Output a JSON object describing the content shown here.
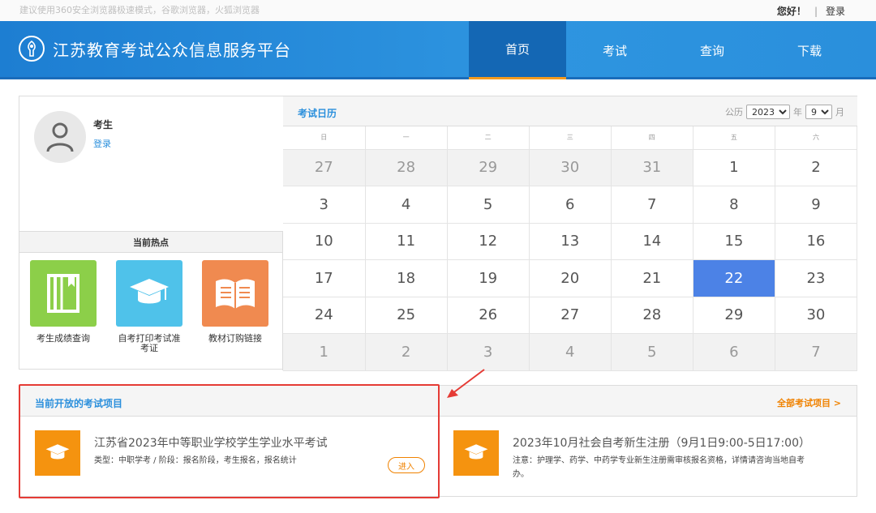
{
  "topbar": {
    "browser_tip": "建议使用360安全浏览器极速模式，谷歌浏览器，火狐浏览器",
    "greeting": "您好！",
    "separator": "|",
    "login": "登录"
  },
  "header": {
    "site_title": "江苏教育考试公众信息服务平台",
    "nav": [
      {
        "label": "首页",
        "active": true
      },
      {
        "label": "考试",
        "active": false
      },
      {
        "label": "查询",
        "active": false
      },
      {
        "label": "下载",
        "active": false
      }
    ]
  },
  "user": {
    "name": "考生",
    "login_link": "登录"
  },
  "hot": {
    "title": "当前热点",
    "tiles": [
      {
        "label": "考生成绩查询",
        "color": "#8ccf49",
        "icon": "notebook-icon"
      },
      {
        "label": "自考打印考试准考证",
        "color": "#4fc2ea",
        "icon": "graduation-cap-icon"
      },
      {
        "label": "教材订购链接",
        "color": "#f08a50",
        "icon": "open-book-icon"
      }
    ]
  },
  "calendar": {
    "title": "考试日历",
    "calendar_type": "公历",
    "year": "2023",
    "year_unit": "年",
    "month": "9",
    "month_unit": "月",
    "year_options": [
      "2023"
    ],
    "month_options": [
      "9"
    ],
    "weekdays": [
      "日",
      "一",
      "二",
      "三",
      "四",
      "五",
      "六"
    ],
    "weeks": [
      [
        {
          "d": "27",
          "o": true
        },
        {
          "d": "28",
          "o": true
        },
        {
          "d": "29",
          "o": true
        },
        {
          "d": "30",
          "o": true
        },
        {
          "d": "31",
          "o": true
        },
        {
          "d": "1",
          "o": false
        },
        {
          "d": "2",
          "o": false
        }
      ],
      [
        {
          "d": "3",
          "o": false
        },
        {
          "d": "4",
          "o": false
        },
        {
          "d": "5",
          "o": false
        },
        {
          "d": "6",
          "o": false
        },
        {
          "d": "7",
          "o": false
        },
        {
          "d": "8",
          "o": false
        },
        {
          "d": "9",
          "o": false
        }
      ],
      [
        {
          "d": "10",
          "o": false
        },
        {
          "d": "11",
          "o": false
        },
        {
          "d": "12",
          "o": false
        },
        {
          "d": "13",
          "o": false
        },
        {
          "d": "14",
          "o": false
        },
        {
          "d": "15",
          "o": false
        },
        {
          "d": "16",
          "o": false
        }
      ],
      [
        {
          "d": "17",
          "o": false
        },
        {
          "d": "18",
          "o": false
        },
        {
          "d": "19",
          "o": false
        },
        {
          "d": "20",
          "o": false
        },
        {
          "d": "21",
          "o": false
        },
        {
          "d": "22",
          "o": false,
          "today": true
        },
        {
          "d": "23",
          "o": false
        }
      ],
      [
        {
          "d": "24",
          "o": false
        },
        {
          "d": "25",
          "o": false
        },
        {
          "d": "26",
          "o": false
        },
        {
          "d": "27",
          "o": false
        },
        {
          "d": "28",
          "o": false
        },
        {
          "d": "29",
          "o": false
        },
        {
          "d": "30",
          "o": false
        }
      ],
      [
        {
          "d": "1",
          "o": true
        },
        {
          "d": "2",
          "o": true
        },
        {
          "d": "3",
          "o": true
        },
        {
          "d": "4",
          "o": true
        },
        {
          "d": "5",
          "o": true
        },
        {
          "d": "6",
          "o": true
        },
        {
          "d": "7",
          "o": true
        }
      ]
    ]
  },
  "projects": {
    "title": "当前开放的考试项目",
    "all_link": "全部考试项目 >",
    "items": [
      {
        "name": "江苏省2023年中等职业学校学生学业水平考试",
        "desc": "类型：中职学考 / 阶段：报名阶段，考生报名，报名统计",
        "enter": "进入"
      },
      {
        "name": "2023年10月社会自考新生注册（9月1日9:00-5日17:00）",
        "desc_line1": "注意：护理学、药学、中药学专业新生注册需审核报名资格，详情请咨询当地自考",
        "desc_line2": "办。"
      }
    ]
  },
  "colors": {
    "header_blue": "#2a8fdc",
    "nav_active": "#1467b4",
    "nav_underline": "#f39a1e",
    "today": "#4c82e6",
    "accent_orange": "#f08200",
    "highlight_red": "#e53b35"
  }
}
